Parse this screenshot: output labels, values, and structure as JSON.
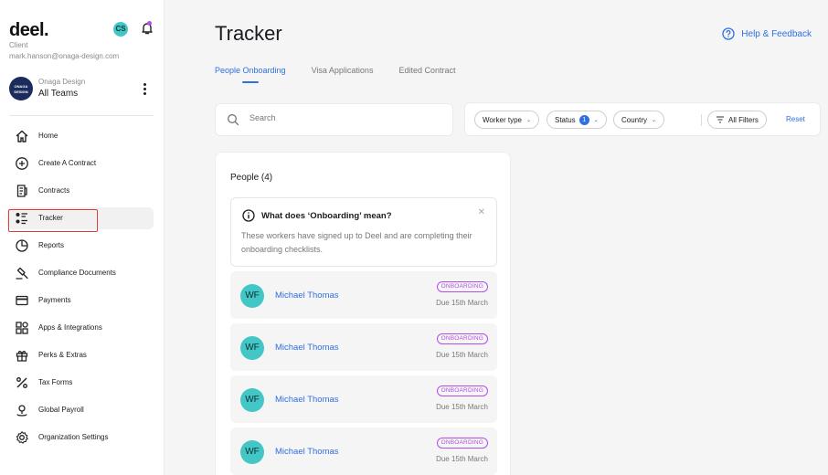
{
  "sidebar": {
    "logo": "deel.",
    "user_initials": "CS",
    "role": "Client",
    "email": "mark.hanson@onaga-design.com",
    "org": {
      "logo_text": "ONAGA DESIGN",
      "name": "Onaga Design",
      "team": "All Teams"
    },
    "items": [
      {
        "label": "Home",
        "icon": "home-icon"
      },
      {
        "label": "Create A Contract",
        "icon": "plus-circle-icon"
      },
      {
        "label": "Contracts",
        "icon": "document-icon"
      },
      {
        "label": "Tracker",
        "icon": "tracker-list-icon",
        "active": true
      },
      {
        "label": "Reports",
        "icon": "pie-chart-icon"
      },
      {
        "label": "Compliance Documents",
        "icon": "gavel-icon"
      },
      {
        "label": "Payments",
        "icon": "card-icon"
      },
      {
        "label": "Apps & Integrations",
        "icon": "apps-grid-icon"
      },
      {
        "label": "Perks & Extras",
        "icon": "gift-icon"
      },
      {
        "label": "Tax Forms",
        "icon": "percent-icon"
      },
      {
        "label": "Global Payroll",
        "icon": "location-pin-icon"
      },
      {
        "label": "Organization Settings",
        "icon": "gear-icon"
      }
    ]
  },
  "header": {
    "title": "Tracker",
    "help_label": "Help & Feedback"
  },
  "tabs": [
    {
      "label": "People Onboarding",
      "active": true
    },
    {
      "label": "Visa Applications"
    },
    {
      "label": "Edited Contract"
    }
  ],
  "search": {
    "placeholder": "Search"
  },
  "filters": {
    "worker_type": "Worker type",
    "status": "Status",
    "status_count": "1",
    "country": "Country",
    "all_filters": "All Filters",
    "reset": "Reset"
  },
  "people": {
    "title": "People (4)",
    "info": {
      "title": "What does ‘Onboarding’ mean?",
      "text": "These workers have signed up to Deel and are completing their onboarding checklists."
    },
    "list": [
      {
        "initials": "WF",
        "name": "Michael Thomas",
        "badge": "ONBOARDING",
        "due": "Due 15th March"
      },
      {
        "initials": "WF",
        "name": "Michael Thomas",
        "badge": "ONBOARDING",
        "due": "Due 15th March"
      },
      {
        "initials": "WF",
        "name": "Michael Thomas",
        "badge": "ONBOARDING",
        "due": "Due 15th March"
      },
      {
        "initials": "WF",
        "name": "Michael Thomas",
        "badge": "ONBOARDING",
        "due": "Due 15th March"
      }
    ]
  },
  "colors": {
    "accent": "#2f6fe0",
    "avatar": "#43c6c6",
    "badge": "#b14fe6",
    "highlight": "#e23b3b"
  }
}
